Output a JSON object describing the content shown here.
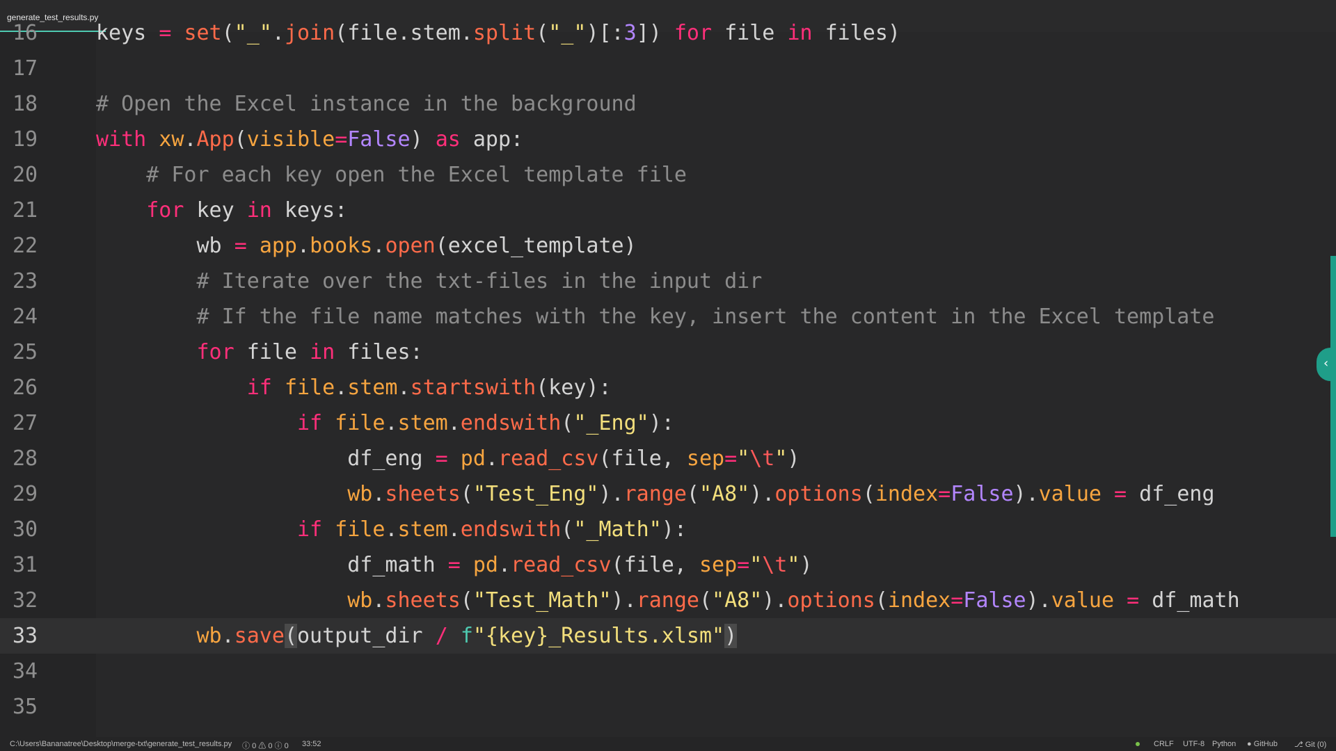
{
  "tab": {
    "filename": "generate_test_results.py"
  },
  "editor": {
    "lines": [
      {
        "num": "16",
        "text": "keys = set(\"_\".join(file.stem.split(\"_\")[:3]) for file in files)"
      },
      {
        "num": "17",
        "text": ""
      },
      {
        "num": "18",
        "text": "# Open the Excel instance in the background"
      },
      {
        "num": "19",
        "text": "with xw.App(visible=False) as app:"
      },
      {
        "num": "20",
        "text": "    # For each key open the Excel template file"
      },
      {
        "num": "21",
        "text": "    for key in keys:"
      },
      {
        "num": "22",
        "text": "        wb = app.books.open(excel_template)"
      },
      {
        "num": "23",
        "text": "        # Iterate over the txt-files in the input dir"
      },
      {
        "num": "24",
        "text": "        # If the file name matches with the key, insert the content in the Excel template"
      },
      {
        "num": "25",
        "text": "        for file in files:"
      },
      {
        "num": "26",
        "text": "            if file.stem.startswith(key):"
      },
      {
        "num": "27",
        "text": "                if file.stem.endswith(\"_Eng\"):"
      },
      {
        "num": "28",
        "text": "                    df_eng = pd.read_csv(file, sep=\"\\t\")"
      },
      {
        "num": "29",
        "text": "                    wb.sheets(\"Test_Eng\").range(\"A8\").options(index=False).value = df_eng"
      },
      {
        "num": "30",
        "text": "                if file.stem.endswith(\"_Math\"):"
      },
      {
        "num": "31",
        "text": "                    df_math = pd.read_csv(file, sep=\"\\t\")"
      },
      {
        "num": "32",
        "text": "                    wb.sheets(\"Test_Math\").range(\"A8\").options(index=False).value = df_math"
      },
      {
        "num": "33",
        "text": "        wb.save(output_dir / f\"{key}_Results.xlsm\")"
      },
      {
        "num": "34",
        "text": ""
      },
      {
        "num": "35",
        "text": ""
      }
    ]
  },
  "statusbar": {
    "path": "C:\\Users\\Bananatree\\Desktop\\merge-txt\\generate_test_results.py",
    "errors": "0",
    "warnings": "0",
    "infos": "0",
    "cursor_pos": "33:52",
    "line_ending": "CRLF",
    "encoding": "UTF-8",
    "language": "Python",
    "github": "GitHub",
    "git": "Git (0)"
  }
}
